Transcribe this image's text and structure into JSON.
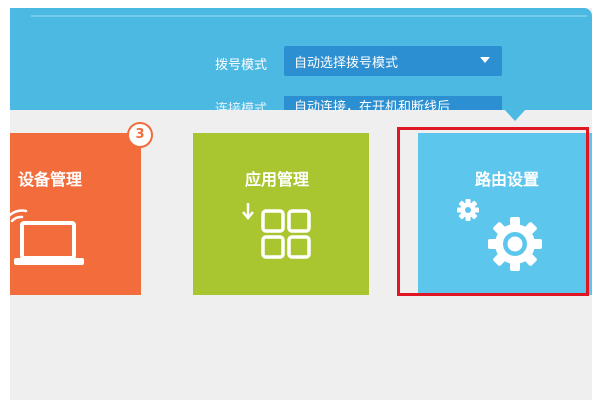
{
  "config": {
    "dial_mode_label": "拨号模式",
    "dial_mode_value": "自动选择拨号模式",
    "second_label": "连接模式",
    "second_value": "自动连接，在开机和断线后"
  },
  "tiles": {
    "device": {
      "title": "设备管理",
      "badge": "3",
      "color": "#f26c3c"
    },
    "app": {
      "title": "应用管理",
      "color": "#a9c630"
    },
    "router": {
      "title": "路由设置",
      "color": "#5cc6ec"
    }
  },
  "icons": {
    "device": "laptop-wifi-icon",
    "app": "app-grid-download-icon",
    "router": "gear-icon"
  },
  "highlight_color": "#e01623"
}
